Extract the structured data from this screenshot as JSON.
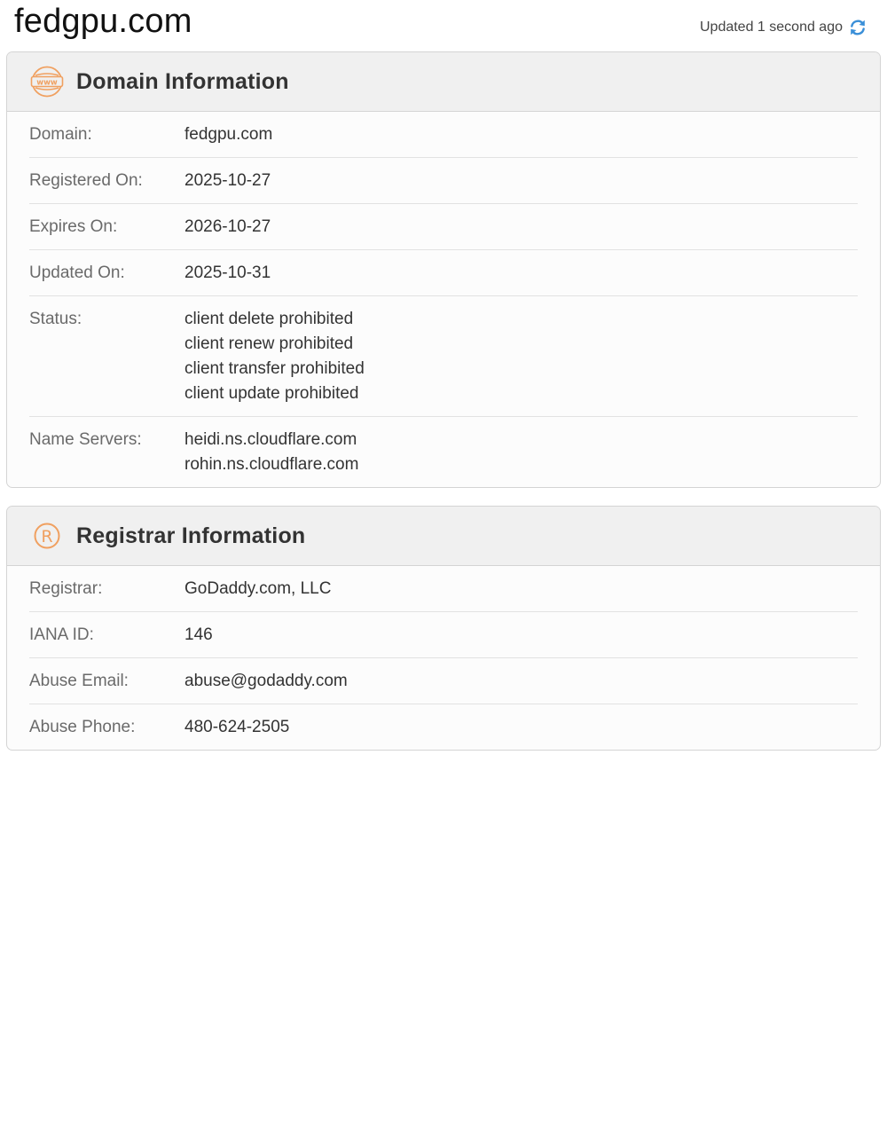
{
  "header": {
    "title": "fedgpu.com",
    "updated_text": "Updated 1 second ago",
    "refresh_icon": "refresh-icon"
  },
  "domain_card": {
    "title": "Domain Information",
    "icon": "www-icon",
    "rows": {
      "domain": {
        "label": "Domain:",
        "value": "fedgpu.com"
      },
      "registered": {
        "label": "Registered On:",
        "value": "2025-10-27"
      },
      "expires": {
        "label": "Expires On:",
        "value": "2026-10-27"
      },
      "updated": {
        "label": "Updated On:",
        "value": "2025-10-31"
      },
      "status": {
        "label": "Status:",
        "values": [
          "client delete prohibited",
          "client renew prohibited",
          "client transfer prohibited",
          "client update prohibited"
        ]
      },
      "name_servers": {
        "label": "Name Servers:",
        "values": [
          "heidi.ns.cloudflare.com",
          "rohin.ns.cloudflare.com"
        ]
      }
    }
  },
  "registrar_card": {
    "title": "Registrar Information",
    "icon": "registered-trademark-icon",
    "rows": {
      "registrar": {
        "label": "Registrar:",
        "value": "GoDaddy.com, LLC"
      },
      "iana_id": {
        "label": "IANA ID:",
        "value": "146"
      },
      "abuse_email": {
        "label": "Abuse Email:",
        "value": "abuse@godaddy.com"
      },
      "abuse_phone": {
        "label": "Abuse Phone:",
        "value": "480-624-2505"
      }
    }
  },
  "colors": {
    "accent_orange": "#f0a060",
    "refresh_blue": "#3a8fd8",
    "header_bg": "#f0f0f0",
    "border": "#d4d4d4"
  }
}
